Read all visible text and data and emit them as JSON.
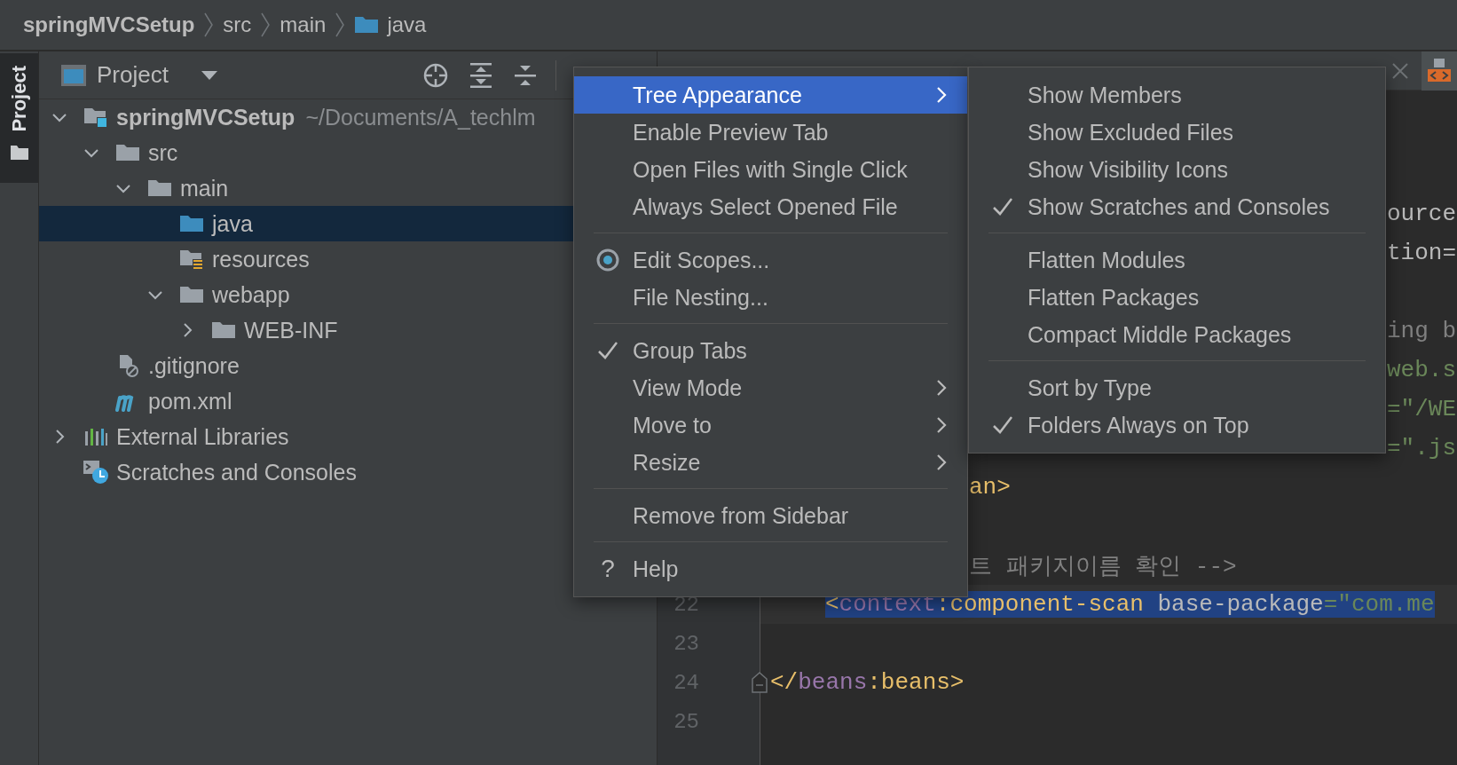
{
  "breadcrumbs": [
    {
      "label": "springMVCSetup",
      "kind": "module"
    },
    {
      "label": "src",
      "kind": "directory"
    },
    {
      "label": "main",
      "kind": "directory"
    },
    {
      "label": "java",
      "kind": "source-folder"
    }
  ],
  "tool_stripe": {
    "tabs": [
      {
        "label": "Project",
        "selected": true
      }
    ]
  },
  "project_panel": {
    "title": "Project",
    "tree": [
      {
        "label": "springMVCSetup",
        "kind": "module",
        "hint": "~/Documents/A_techlm",
        "expanded": true,
        "selected": false,
        "children": [
          {
            "label": "src",
            "kind": "folder",
            "expanded": true,
            "selected": false,
            "children": [
              {
                "label": "main",
                "kind": "folder",
                "expanded": true,
                "selected": false,
                "children": [
                  {
                    "label": "java",
                    "kind": "source-folder",
                    "selected": true
                  },
                  {
                    "label": "resources",
                    "kind": "resource-folder",
                    "selected": false
                  },
                  {
                    "label": "webapp",
                    "kind": "folder",
                    "expanded": true,
                    "selected": false,
                    "children": [
                      {
                        "label": "WEB-INF",
                        "kind": "folder",
                        "expanded": false,
                        "selected": false
                      }
                    ]
                  }
                ]
              }
            ]
          },
          {
            "label": ".gitignore",
            "kind": "ignore-file",
            "selected": false
          },
          {
            "label": "pom.xml",
            "kind": "maven-file",
            "selected": false
          }
        ]
      },
      {
        "label": "External Libraries",
        "kind": "libraries",
        "expanded": false,
        "selected": false
      },
      {
        "label": "Scratches and Consoles",
        "kind": "scratches",
        "selected": false
      }
    ]
  },
  "editor": {
    "lines": [
      {
        "kind": "blank"
      },
      {
        "kind": "blank"
      },
      {
        "kind": "under-submenu",
        "selected": false,
        "tokens": [
          {
            "text": "ource",
            "kind": "plain"
          }
        ]
      },
      {
        "kind": "under-submenu",
        "selected": false,
        "tokens": [
          {
            "text": "tion=",
            "kind": "plain"
          }
        ]
      },
      {
        "kind": "blank"
      },
      {
        "kind": "under-submenu",
        "selected": false,
        "tokens": [
          {
            "text": "ing b",
            "kind": "comment"
          }
        ]
      },
      {
        "kind": "under-submenu",
        "selected": false,
        "tokens": [
          {
            "text": "web.s",
            "kind": "string"
          }
        ]
      },
      {
        "kind": "under-submenu",
        "selected": false,
        "tokens": [
          {
            "text": "=\"/WE",
            "kind": "string"
          }
        ]
      },
      {
        "kind": "under-submenu",
        "selected": false,
        "tokens": [
          {
            "text": "=\".js",
            "kind": "string"
          }
        ]
      },
      {
        "kind": "under-menu",
        "selected": false,
        "tokens": [
          {
            "text": "an>",
            "kind": "tag"
          }
        ]
      },
      {
        "kind": "blank"
      },
      {
        "kind": "under-menu",
        "selected": false,
        "tokens": [
          {
            "text": "트 패키지이름 확인 -->",
            "kind": "comment"
          }
        ]
      },
      {
        "kind": "nested",
        "number": "22",
        "selected": true,
        "tokens": [
          {
            "text": "<",
            "kind": "tag"
          },
          {
            "text": "context",
            "kind": "namespace"
          },
          {
            "text": ":component-scan",
            "kind": "tag"
          },
          {
            "text": " base-package",
            "kind": "attribute"
          },
          {
            "text": "=\"com.me",
            "kind": "string"
          }
        ]
      },
      {
        "kind": "blank",
        "number": "23"
      },
      {
        "kind": "fold-end",
        "number": "24",
        "selected": false,
        "tokens": [
          {
            "text": "</",
            "kind": "tag"
          },
          {
            "text": "beans",
            "kind": "namespace"
          },
          {
            "text": ":beans>",
            "kind": "tag"
          }
        ]
      },
      {
        "kind": "blank",
        "number": "25"
      }
    ]
  },
  "context_menu": {
    "items": [
      {
        "kind": "item",
        "label": "Tree Appearance",
        "selected": true,
        "checked": false,
        "has_submenu": true
      },
      {
        "kind": "item",
        "label": "Enable Preview Tab",
        "selected": false,
        "checked": false,
        "has_submenu": false
      },
      {
        "kind": "item",
        "label": "Open Files with Single Click",
        "selected": false,
        "checked": false,
        "has_submenu": false
      },
      {
        "kind": "item",
        "label": "Always Select Opened File",
        "selected": false,
        "checked": false,
        "has_submenu": false
      },
      {
        "kind": "separator"
      },
      {
        "kind": "scopes-item",
        "label": "Edit Scopes...",
        "selected": false,
        "checked": false,
        "has_submenu": false
      },
      {
        "kind": "item",
        "label": "File Nesting...",
        "selected": false,
        "checked": false,
        "has_submenu": false
      },
      {
        "kind": "separator"
      },
      {
        "kind": "item",
        "label": "Group Tabs",
        "selected": false,
        "checked": true,
        "has_submenu": false
      },
      {
        "kind": "item",
        "label": "View Mode",
        "selected": false,
        "checked": false,
        "has_submenu": true
      },
      {
        "kind": "item",
        "label": "Move to",
        "selected": false,
        "checked": false,
        "has_submenu": true
      },
      {
        "kind": "item",
        "label": "Resize",
        "selected": false,
        "checked": false,
        "has_submenu": true
      },
      {
        "kind": "separator"
      },
      {
        "kind": "item",
        "label": "Remove from Sidebar",
        "selected": false,
        "checked": false,
        "has_submenu": false
      },
      {
        "kind": "separator"
      },
      {
        "kind": "glyph-item",
        "glyph": "?",
        "label": "Help",
        "selected": false,
        "checked": false,
        "has_submenu": false
      }
    ]
  },
  "submenu": {
    "items": [
      {
        "kind": "item",
        "label": "Show Members",
        "selected": false,
        "checked": false,
        "has_submenu": false
      },
      {
        "kind": "item",
        "label": "Show Excluded Files",
        "selected": false,
        "checked": false,
        "has_submenu": false
      },
      {
        "kind": "item",
        "label": "Show Visibility Icons",
        "selected": false,
        "checked": false,
        "has_submenu": false
      },
      {
        "kind": "item",
        "label": "Show Scratches and Consoles",
        "selected": false,
        "checked": true,
        "has_submenu": false
      },
      {
        "kind": "separator"
      },
      {
        "kind": "item",
        "label": "Flatten Modules",
        "selected": false,
        "checked": false,
        "has_submenu": false
      },
      {
        "kind": "item",
        "label": "Flatten Packages",
        "selected": false,
        "checked": false,
        "has_submenu": false
      },
      {
        "kind": "item",
        "label": "Compact Middle Packages",
        "selected": false,
        "checked": false,
        "has_submenu": false
      },
      {
        "kind": "separator"
      },
      {
        "kind": "item",
        "label": "Sort by Type",
        "selected": false,
        "checked": false,
        "has_submenu": false
      },
      {
        "kind": "item",
        "label": "Folders Always on Top",
        "selected": false,
        "checked": true,
        "has_submenu": false
      }
    ]
  }
}
